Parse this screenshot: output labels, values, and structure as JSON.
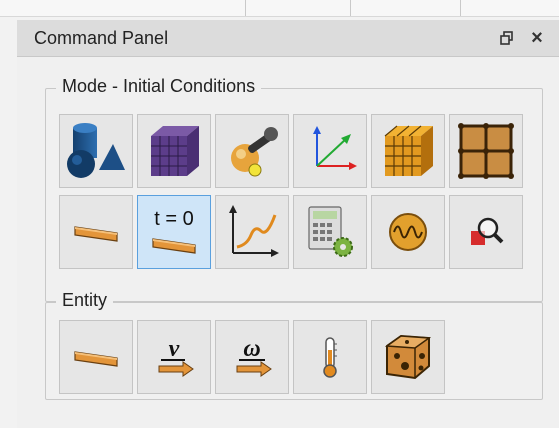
{
  "panel": {
    "title": "Command Panel",
    "restore_glyph": "🗗",
    "close_glyph": "×"
  },
  "mode_group": {
    "legend": "Mode - Initial Conditions",
    "row1": [
      {
        "id": "geometry",
        "icon": "geometry-shapes-icon"
      },
      {
        "id": "mesh",
        "icon": "mesh-cube-icon"
      },
      {
        "id": "setup",
        "icon": "wrench-tools-icon"
      },
      {
        "id": "coordinates",
        "icon": "coordinate-axes-icon"
      },
      {
        "id": "blocks",
        "icon": "orange-grid-cube-icon"
      },
      {
        "id": "grid",
        "icon": "brown-grid-icon"
      }
    ],
    "row2": [
      {
        "id": "boundary",
        "icon": "beam-icon"
      },
      {
        "id": "initial-conditions",
        "icon": "t-zero-beam-icon",
        "text": "t = 0",
        "active": true
      },
      {
        "id": "plot",
        "icon": "curve-graph-icon"
      },
      {
        "id": "calculator",
        "icon": "calculator-gear-icon"
      },
      {
        "id": "signal",
        "icon": "sine-wave-icon"
      },
      {
        "id": "inspect",
        "icon": "magnifier-icon"
      }
    ]
  },
  "entity_group": {
    "legend": "Entity",
    "tools": [
      {
        "id": "body",
        "icon": "beam-icon"
      },
      {
        "id": "velocity",
        "icon": "velocity-arrow-icon",
        "text": "v"
      },
      {
        "id": "angular-velocity",
        "icon": "omega-arrow-icon",
        "text": "ω"
      },
      {
        "id": "temperature",
        "icon": "thermometer-icon"
      },
      {
        "id": "material",
        "icon": "cheese-block-icon"
      }
    ]
  },
  "colors": {
    "accent_border": "#5aa0de",
    "active_bg": "#cfe5f8",
    "tool_bg": "#e6e6e6",
    "header_bg": "#dcdcdc"
  }
}
